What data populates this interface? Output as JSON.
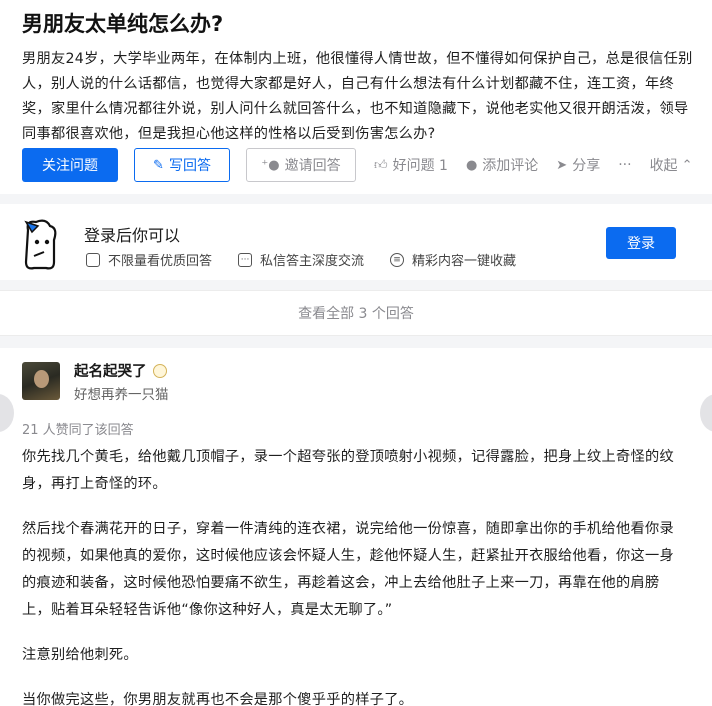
{
  "question": {
    "title": "男朋友太单纯怎么办?",
    "description": "男朋友24岁，大学毕业两年，在体制内上班，他很懂得人情世故，但不懂得如何保护自己，总是很信任别人，别人说的什么话都信，也觉得大家都是好人，自己有什么想法有什么计划都藏不住，连工资，年终奖，家里什么情况都往外说，别人问什么就回答什么，也不知道隐藏下，说他老实他又很开朗活泼，领导同事都很喜欢他，但是我担心他这样的性格以后受到伤害怎么办?"
  },
  "actions": {
    "follow": "关注问题",
    "write": "写回答",
    "invite": "邀请回答",
    "good": "好问题 1",
    "comment": "添加评论",
    "share": "分享",
    "more": "···",
    "collapse": "收起"
  },
  "login": {
    "title": "登录后你可以",
    "perks": [
      "不限量看优质回答",
      "私信答主深度交流",
      "精彩内容一键收藏"
    ],
    "button": "登录"
  },
  "all_answers": "查看全部 3 个回答",
  "answer": {
    "author": "起名起哭了",
    "bio": "好想再养一只猫",
    "likes": "21 人赞同了该回答",
    "paragraphs": [
      "你先找几个黄毛，给他戴几顶帽子，录一个超夸张的登顶喷射小视频，记得露脸，把身上纹上奇怪的纹身，再打上奇怪的环。",
      "然后找个春满花开的日子，穿着一件清纯的连衣裙，说完给他一份惊喜，随即拿出你的手机给他看你录的视频，如果他真的爱你，这时候他应该会怀疑人生，趁他怀疑人生，赶紧扯开衣服给他看，你这一身的痕迹和装备，这时候他恐怕要痛不欲生，再趁着这会，冲上去给他肚子上来一刀，再靠在他的肩膀上，贴着耳朵轻轻告诉他“像你这种好人，真是太无聊了。”",
      "注意别给他刺死。",
      "当你做完这些，你男朋友就再也不会是那个傻乎乎的样子了。"
    ]
  }
}
